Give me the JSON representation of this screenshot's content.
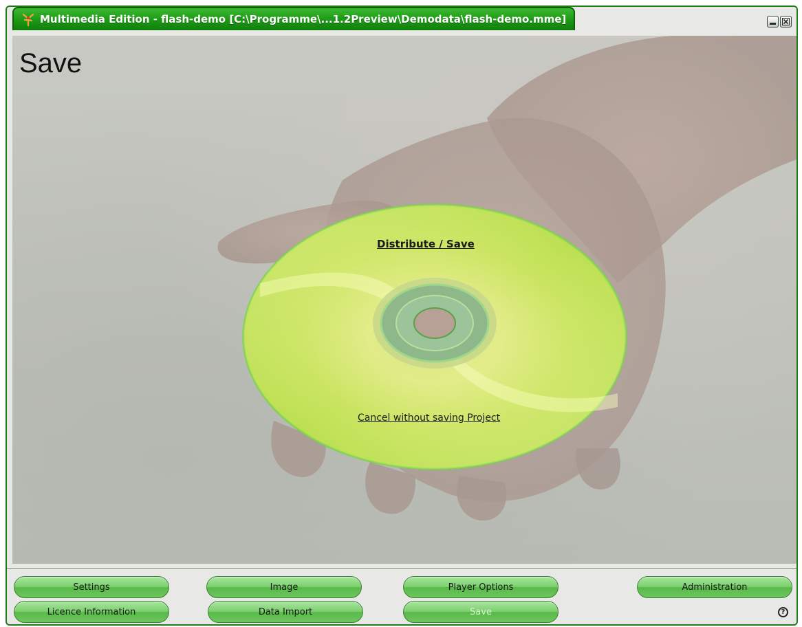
{
  "window": {
    "title": "Multimedia Edition - flash-demo [C:\\Programme\\...1.2Preview\\Demodata\\flash-demo.mme]"
  },
  "page": {
    "heading": "Save"
  },
  "disc": {
    "primary_link": "Distribute / Save",
    "secondary_link": "Cancel without saving Project"
  },
  "footer": {
    "buttons": [
      {
        "label": "Settings"
      },
      {
        "label": "Image"
      },
      {
        "label": "Player Options"
      },
      {
        "label": "Administration"
      },
      {
        "label": "Licence Information"
      },
      {
        "label": "Data Import"
      },
      {
        "label": "Save",
        "disabled": true
      }
    ],
    "help_glyph": "?"
  },
  "icons": {
    "app_logo": "app-logo-icon",
    "minimize": "minimize-icon",
    "close": "close-icon",
    "help": "help-icon"
  },
  "colors": {
    "accent": "#1e9b16",
    "button": "#7dcf6f",
    "disc": "#e9ee88"
  }
}
